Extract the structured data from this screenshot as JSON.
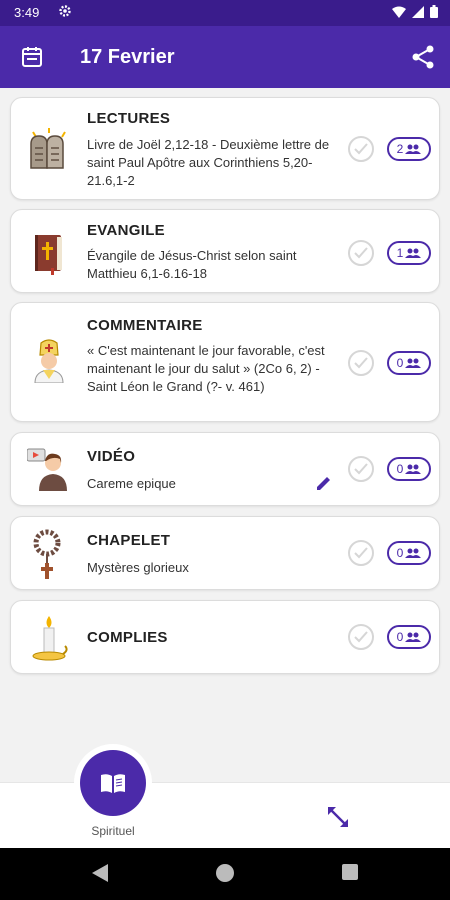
{
  "status": {
    "time": "3:49"
  },
  "header": {
    "title": "17 Fevrier"
  },
  "colors": {
    "primary": "#4b2aa9",
    "status_bar": "#3a1c8c"
  },
  "cards": [
    {
      "icon": "tablets-icon",
      "title": "LECTURES",
      "subtitle": "Livre de Joël  2,12-18 - Deuxième lettre de saint Paul Apôtre aux Corinthiens  5,20-21.6,1-2",
      "count": "2"
    },
    {
      "icon": "bible-icon",
      "title": "EVANGILE",
      "subtitle": "Évangile de Jésus-Christ selon saint Matthieu  6,1-6.16-18",
      "count": "1"
    },
    {
      "icon": "pope-icon",
      "title": "COMMENTAIRE",
      "subtitle": "« C'est maintenant le jour favorable, c'est maintenant le jour du salut » (2Co 6, 2) - Saint Léon le Grand (?- v. 461)",
      "count": "0"
    },
    {
      "icon": "video-presenter-icon",
      "title": "VIDÉO",
      "subtitle": "Careme epique",
      "count": "0"
    },
    {
      "icon": "rosary-icon",
      "title": "CHAPELET",
      "subtitle": "Mystères glorieux",
      "count": "0"
    },
    {
      "icon": "candle-icon",
      "title": "COMPLIES",
      "subtitle": "",
      "count": "0"
    }
  ],
  "bottom_nav": {
    "spiritual_label": "Spirituel"
  }
}
